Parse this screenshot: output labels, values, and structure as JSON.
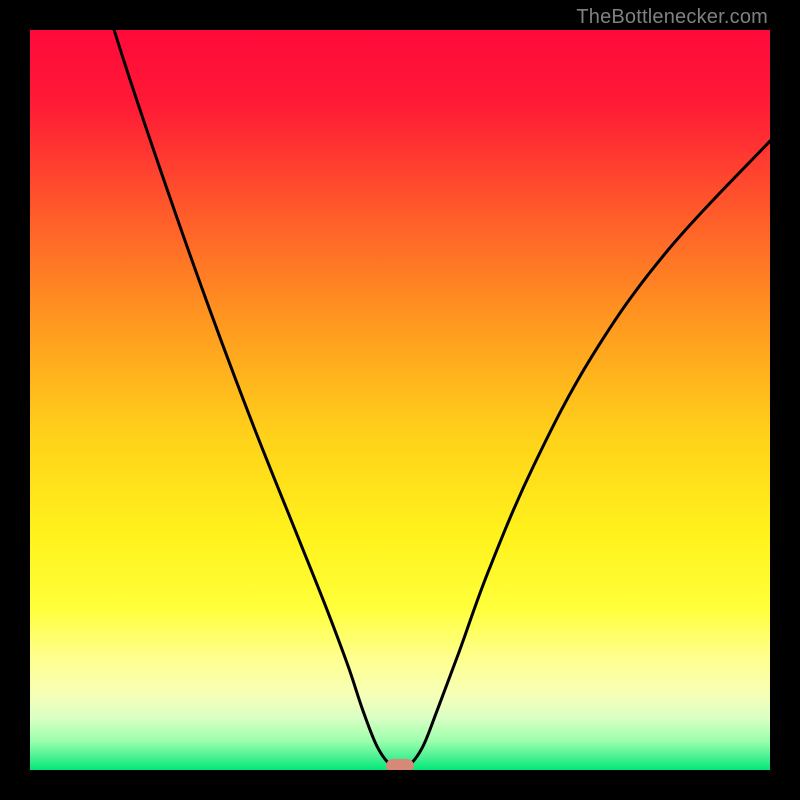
{
  "watermark": "TheBottlenecker.com",
  "chart_data": {
    "type": "line",
    "title": "",
    "xlabel": "",
    "ylabel": "",
    "xlim": [
      0,
      100
    ],
    "ylim": [
      0,
      100
    ],
    "series": [
      {
        "name": "bottleneck-curve",
        "x": [
          0,
          6,
          12,
          18,
          24,
          30,
          36,
          40,
          43,
          45,
          47,
          49,
          51,
          53,
          55,
          58,
          62,
          68,
          76,
          86,
          100
        ],
        "values": [
          140,
          118,
          98,
          80,
          63,
          47,
          32,
          22,
          14,
          8,
          3,
          0.5,
          0.5,
          3,
          8,
          16,
          27,
          41,
          56,
          70,
          85
        ]
      }
    ],
    "annotations": [
      {
        "name": "min-marker",
        "x": 50,
        "y": 0.5,
        "color": "#d58a78"
      }
    ],
    "background_gradient": {
      "stops": [
        {
          "offset": 0.0,
          "color": "#ff0a3a"
        },
        {
          "offset": 0.1,
          "color": "#ff1a36"
        },
        {
          "offset": 0.25,
          "color": "#ff5c2a"
        },
        {
          "offset": 0.4,
          "color": "#ff9a1f"
        },
        {
          "offset": 0.55,
          "color": "#ffd21a"
        },
        {
          "offset": 0.68,
          "color": "#fff21c"
        },
        {
          "offset": 0.78,
          "color": "#ffff3a"
        },
        {
          "offset": 0.85,
          "color": "#ffff90"
        },
        {
          "offset": 0.9,
          "color": "#f6ffb8"
        },
        {
          "offset": 0.93,
          "color": "#d8ffc4"
        },
        {
          "offset": 0.96,
          "color": "#9effad"
        },
        {
          "offset": 0.985,
          "color": "#40f090"
        },
        {
          "offset": 1.0,
          "color": "#00e878"
        }
      ]
    }
  }
}
